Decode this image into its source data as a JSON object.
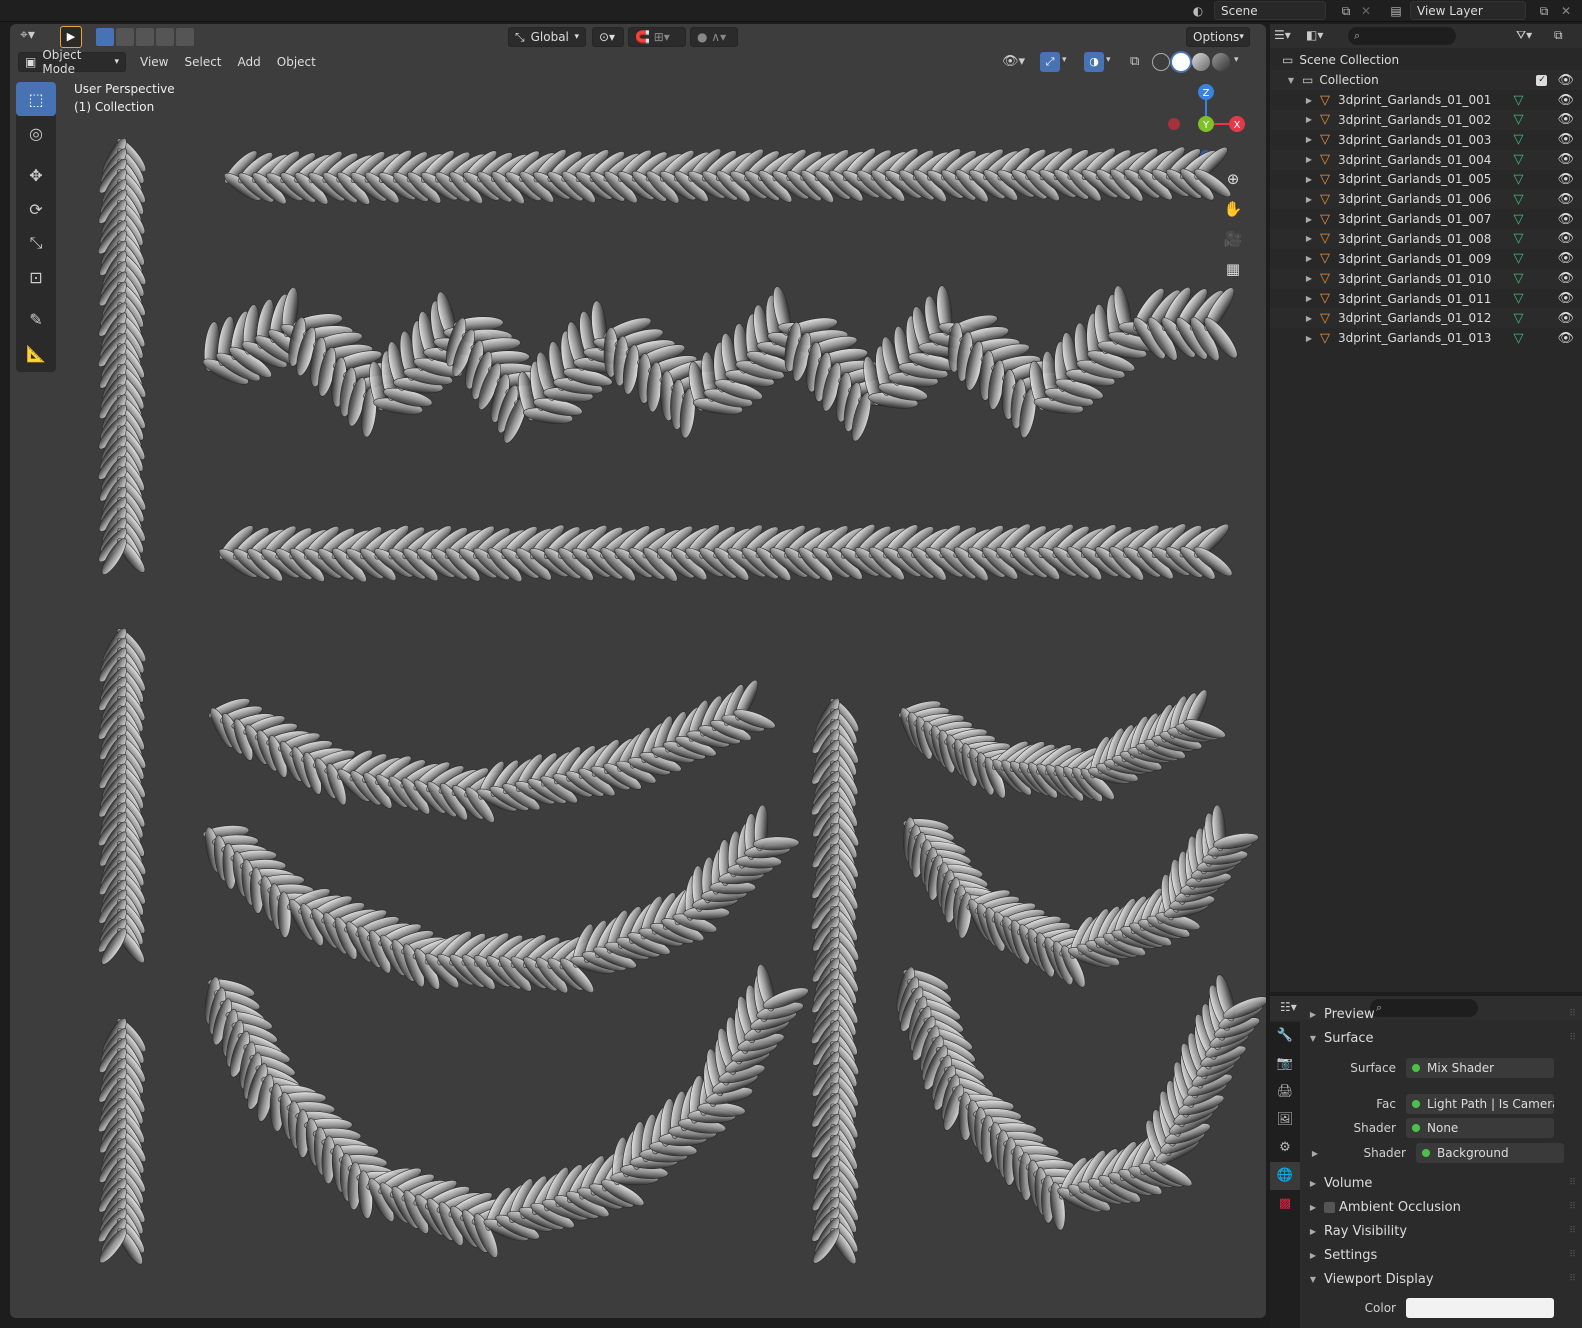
{
  "topbar": {
    "scene": "Scene",
    "view_layer": "View Layer"
  },
  "viewport_header": {
    "orientation": "Global",
    "options": "Options",
    "mode": "Object Mode",
    "menus": [
      "View",
      "Select",
      "Add",
      "Object"
    ]
  },
  "overlay": {
    "perspective": "User Perspective",
    "collection": "(1) Collection"
  },
  "gizmo": {
    "z": "Z",
    "y": "Y",
    "x": "X"
  },
  "outliner": {
    "scene_collection": "Scene Collection",
    "collection": "Collection",
    "objects": [
      "3dprint_Garlands_01_001",
      "3dprint_Garlands_01_002",
      "3dprint_Garlands_01_003",
      "3dprint_Garlands_01_004",
      "3dprint_Garlands_01_005",
      "3dprint_Garlands_01_006",
      "3dprint_Garlands_01_007",
      "3dprint_Garlands_01_008",
      "3dprint_Garlands_01_009",
      "3dprint_Garlands_01_010",
      "3dprint_Garlands_01_011",
      "3dprint_Garlands_01_012",
      "3dprint_Garlands_01_013"
    ]
  },
  "properties": {
    "panels": {
      "preview": "Preview",
      "surface": "Surface",
      "volume": "Volume",
      "ambient_occlusion": "Ambient Occlusion",
      "ray_visibility": "Ray Visibility",
      "settings": "Settings",
      "viewport_display": "Viewport Display"
    },
    "fields": {
      "surface_label": "Surface",
      "surface_value": "Mix Shader",
      "fac_label": "Fac",
      "fac_value": "Light Path | Is Camera R...",
      "shader1_label": "Shader",
      "shader1_value": "None",
      "shader2_label": "Shader",
      "shader2_value": "Background",
      "color_label": "Color"
    }
  },
  "colors": {
    "accent": "#4772b3",
    "mesh_icon": "#e8903a",
    "data_icon": "#3dbd7d",
    "axis_x": "#e5394a",
    "axis_y": "#7fbf2a",
    "axis_z": "#3b82e0"
  }
}
